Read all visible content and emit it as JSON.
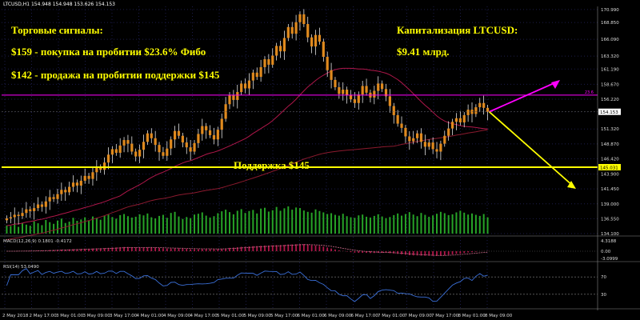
{
  "header": {
    "symbol_info": "LTCUSD,H1  154.948 154.948 153.626 154.153"
  },
  "annotations": {
    "signals_title": "Торговые сигналы:",
    "signal_buy": "$159 -  покупка на пробитии $23.6% Фибо",
    "signal_sell": "$142 - продажа на пробитии поддержки $145",
    "cap_title": "Капитализация LTCUSD:",
    "cap_value": "$9.41 млрд.",
    "support_label": "Поддержка $145"
  },
  "colors": {
    "background": "#000000",
    "bull": "#e08a1e",
    "bear": "#e08a1e",
    "wick": "#ffffff",
    "volume": "#27a327",
    "fibo_line": "#ff00ff",
    "support_line": "#ffff00",
    "ma_fast": "#b0174a",
    "ma_slow": "#8b1a2e",
    "macd_hist": "#b0174a",
    "macd_signal": "#cc6b8a",
    "rsi_line": "#3a6fd8",
    "arrow_up": "#ff00ff",
    "arrow_down": "#ffff00",
    "price_badge": "#ffffff"
  },
  "chart_data": {
    "type": "candlestick",
    "price_axis": {
      "ticks": [
        "170.990",
        "168.850",
        "166.090",
        "163.320",
        "161.190",
        "158.670",
        "156.220",
        "154.153",
        "151.320",
        "148.870",
        "146.420",
        "143.900",
        "141.450",
        "139.000",
        "136.550",
        "134.100"
      ],
      "ylim": [
        134.1,
        171.5
      ]
    },
    "fibo_level": {
      "value": 156.9,
      "label": "23.6"
    },
    "support_level": {
      "value": 145.03,
      "badge": "145.031"
    },
    "current_price": {
      "value": 154.153,
      "badge": "154.153"
    },
    "x_labels": [
      "2 May 2018",
      "2 May 17:00",
      "3 May 01:00",
      "3 May 09:00",
      "3 May 17:00",
      "4 May 01:00",
      "4 May 09:00",
      "4 May 17:00",
      "5 May 01:00",
      "5 May 09:00",
      "5 May 17:00",
      "6 May 01:00",
      "6 May 09:00",
      "6 May 17:00",
      "7 May 01:00",
      "7 May 09:00",
      "7 May 17:00",
      "8 May 01:00",
      "8 May 09:00"
    ],
    "candles_close": [
      136.6,
      136.8,
      137.2,
      137.0,
      137.5,
      138.1,
      137.8,
      138.3,
      138.9,
      138.5,
      139.4,
      140.1,
      139.8,
      140.6,
      141.3,
      140.9,
      141.8,
      142.5,
      142.0,
      142.8,
      143.6,
      143.1,
      144.2,
      145.0,
      144.6,
      145.8,
      147.1,
      148.0,
      147.4,
      148.6,
      149.5,
      148.9,
      147.6,
      146.8,
      147.9,
      149.2,
      150.6,
      149.8,
      148.7,
      147.5,
      146.9,
      148.1,
      149.6,
      151.0,
      150.2,
      149.1,
      148.3,
      147.6,
      149.0,
      150.5,
      151.8,
      151.1,
      150.3,
      149.6,
      151.2,
      153.0,
      155.4,
      156.9,
      156.1,
      157.4,
      158.8,
      158.0,
      159.3,
      160.6,
      159.9,
      161.5,
      162.8,
      161.9,
      163.4,
      165.0,
      164.1,
      166.3,
      168.1,
      167.0,
      168.9,
      170.2,
      168.6,
      166.4,
      164.9,
      166.8,
      165.7,
      163.2,
      161.0,
      159.4,
      158.2,
      157.1,
      157.8,
      156.9,
      156.2,
      155.6,
      157.0,
      158.4,
      157.3,
      156.5,
      157.6,
      158.8,
      157.9,
      156.7,
      155.1,
      153.6,
      152.2,
      151.5,
      150.1,
      149.3,
      149.8,
      150.6,
      149.2,
      148.4,
      149.1,
      148.0,
      147.6,
      148.9,
      150.2,
      151.4,
      152.5,
      153.1,
      152.4,
      153.6,
      154.5,
      153.8,
      154.9,
      155.6,
      154.8,
      154.15
    ],
    "volume": [
      30,
      28,
      35,
      25,
      40,
      33,
      29,
      45,
      38,
      31,
      50,
      42,
      36,
      48,
      55,
      39,
      44,
      58,
      47,
      52,
      60,
      49,
      63,
      57,
      51,
      66,
      70,
      61,
      55,
      68,
      72,
      64,
      59,
      62,
      71,
      67,
      74,
      60,
      56,
      65,
      69,
      58,
      76,
      80,
      63,
      54,
      61,
      57,
      70,
      73,
      78,
      66,
      59,
      64,
      75,
      82,
      88,
      79,
      71,
      84,
      90,
      76,
      83,
      87,
      74,
      92,
      95,
      81,
      86,
      98,
      84,
      93,
      100,
      88,
      96,
      94,
      85,
      80,
      77,
      89,
      83,
      78,
      72,
      75,
      69,
      66,
      73,
      64,
      60,
      58,
      67,
      70,
      62,
      59,
      65,
      71,
      63,
      57,
      61,
      68,
      74,
      66,
      72,
      79,
      70,
      64,
      76,
      69,
      62,
      67,
      73,
      80,
      75,
      68,
      71,
      78,
      84,
      77,
      70,
      74,
      69,
      65,
      72,
      60
    ],
    "macd_panel": {
      "label": "MACD(12,26,9) 0.1801 -0.4172",
      "ticks": [
        "4.3188",
        "0.00",
        "-3.0999"
      ]
    },
    "rsi_panel": {
      "label": "RSI(14) 53.0490",
      "ticks": [
        "70",
        "30"
      ]
    }
  }
}
